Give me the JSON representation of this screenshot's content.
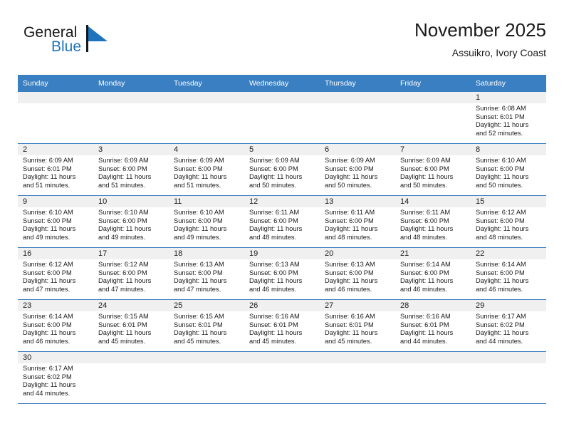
{
  "brand": {
    "name_part1": "General",
    "name_part2": "Blue",
    "flag_icon": "blue-triangle-flag",
    "accent_color": "#1f74bd"
  },
  "header": {
    "title": "November 2025",
    "subtitle": "Assuikro, Ivory Coast"
  },
  "theme": {
    "header_bg": "#3a7fc1",
    "daynum_bg": "#f0f0f0",
    "grid_line": "#3a7fc1",
    "text": "#1a1a1a"
  },
  "weekday_headers": [
    "Sunday",
    "Monday",
    "Tuesday",
    "Wednesday",
    "Thursday",
    "Friday",
    "Saturday"
  ],
  "weeks": [
    [
      {
        "day": "",
        "empty": true
      },
      {
        "day": "",
        "empty": true
      },
      {
        "day": "",
        "empty": true
      },
      {
        "day": "",
        "empty": true
      },
      {
        "day": "",
        "empty": true
      },
      {
        "day": "",
        "empty": true
      },
      {
        "day": "1",
        "sunrise": "Sunrise: 6:08 AM",
        "sunset": "Sunset: 6:01 PM",
        "daylight1": "Daylight: 11 hours",
        "daylight2": "and 52 minutes."
      }
    ],
    [
      {
        "day": "2",
        "sunrise": "Sunrise: 6:09 AM",
        "sunset": "Sunset: 6:01 PM",
        "daylight1": "Daylight: 11 hours",
        "daylight2": "and 51 minutes."
      },
      {
        "day": "3",
        "sunrise": "Sunrise: 6:09 AM",
        "sunset": "Sunset: 6:00 PM",
        "daylight1": "Daylight: 11 hours",
        "daylight2": "and 51 minutes."
      },
      {
        "day": "4",
        "sunrise": "Sunrise: 6:09 AM",
        "sunset": "Sunset: 6:00 PM",
        "daylight1": "Daylight: 11 hours",
        "daylight2": "and 51 minutes."
      },
      {
        "day": "5",
        "sunrise": "Sunrise: 6:09 AM",
        "sunset": "Sunset: 6:00 PM",
        "daylight1": "Daylight: 11 hours",
        "daylight2": "and 50 minutes."
      },
      {
        "day": "6",
        "sunrise": "Sunrise: 6:09 AM",
        "sunset": "Sunset: 6:00 PM",
        "daylight1": "Daylight: 11 hours",
        "daylight2": "and 50 minutes."
      },
      {
        "day": "7",
        "sunrise": "Sunrise: 6:09 AM",
        "sunset": "Sunset: 6:00 PM",
        "daylight1": "Daylight: 11 hours",
        "daylight2": "and 50 minutes."
      },
      {
        "day": "8",
        "sunrise": "Sunrise: 6:10 AM",
        "sunset": "Sunset: 6:00 PM",
        "daylight1": "Daylight: 11 hours",
        "daylight2": "and 50 minutes."
      }
    ],
    [
      {
        "day": "9",
        "sunrise": "Sunrise: 6:10 AM",
        "sunset": "Sunset: 6:00 PM",
        "daylight1": "Daylight: 11 hours",
        "daylight2": "and 49 minutes."
      },
      {
        "day": "10",
        "sunrise": "Sunrise: 6:10 AM",
        "sunset": "Sunset: 6:00 PM",
        "daylight1": "Daylight: 11 hours",
        "daylight2": "and 49 minutes."
      },
      {
        "day": "11",
        "sunrise": "Sunrise: 6:10 AM",
        "sunset": "Sunset: 6:00 PM",
        "daylight1": "Daylight: 11 hours",
        "daylight2": "and 49 minutes."
      },
      {
        "day": "12",
        "sunrise": "Sunrise: 6:11 AM",
        "sunset": "Sunset: 6:00 PM",
        "daylight1": "Daylight: 11 hours",
        "daylight2": "and 48 minutes."
      },
      {
        "day": "13",
        "sunrise": "Sunrise: 6:11 AM",
        "sunset": "Sunset: 6:00 PM",
        "daylight1": "Daylight: 11 hours",
        "daylight2": "and 48 minutes."
      },
      {
        "day": "14",
        "sunrise": "Sunrise: 6:11 AM",
        "sunset": "Sunset: 6:00 PM",
        "daylight1": "Daylight: 11 hours",
        "daylight2": "and 48 minutes."
      },
      {
        "day": "15",
        "sunrise": "Sunrise: 6:12 AM",
        "sunset": "Sunset: 6:00 PM",
        "daylight1": "Daylight: 11 hours",
        "daylight2": "and 48 minutes."
      }
    ],
    [
      {
        "day": "16",
        "sunrise": "Sunrise: 6:12 AM",
        "sunset": "Sunset: 6:00 PM",
        "daylight1": "Daylight: 11 hours",
        "daylight2": "and 47 minutes."
      },
      {
        "day": "17",
        "sunrise": "Sunrise: 6:12 AM",
        "sunset": "Sunset: 6:00 PM",
        "daylight1": "Daylight: 11 hours",
        "daylight2": "and 47 minutes."
      },
      {
        "day": "18",
        "sunrise": "Sunrise: 6:13 AM",
        "sunset": "Sunset: 6:00 PM",
        "daylight1": "Daylight: 11 hours",
        "daylight2": "and 47 minutes."
      },
      {
        "day": "19",
        "sunrise": "Sunrise: 6:13 AM",
        "sunset": "Sunset: 6:00 PM",
        "daylight1": "Daylight: 11 hours",
        "daylight2": "and 46 minutes."
      },
      {
        "day": "20",
        "sunrise": "Sunrise: 6:13 AM",
        "sunset": "Sunset: 6:00 PM",
        "daylight1": "Daylight: 11 hours",
        "daylight2": "and 46 minutes."
      },
      {
        "day": "21",
        "sunrise": "Sunrise: 6:14 AM",
        "sunset": "Sunset: 6:00 PM",
        "daylight1": "Daylight: 11 hours",
        "daylight2": "and 46 minutes."
      },
      {
        "day": "22",
        "sunrise": "Sunrise: 6:14 AM",
        "sunset": "Sunset: 6:00 PM",
        "daylight1": "Daylight: 11 hours",
        "daylight2": "and 46 minutes."
      }
    ],
    [
      {
        "day": "23",
        "sunrise": "Sunrise: 6:14 AM",
        "sunset": "Sunset: 6:00 PM",
        "daylight1": "Daylight: 11 hours",
        "daylight2": "and 46 minutes."
      },
      {
        "day": "24",
        "sunrise": "Sunrise: 6:15 AM",
        "sunset": "Sunset: 6:01 PM",
        "daylight1": "Daylight: 11 hours",
        "daylight2": "and 45 minutes."
      },
      {
        "day": "25",
        "sunrise": "Sunrise: 6:15 AM",
        "sunset": "Sunset: 6:01 PM",
        "daylight1": "Daylight: 11 hours",
        "daylight2": "and 45 minutes."
      },
      {
        "day": "26",
        "sunrise": "Sunrise: 6:16 AM",
        "sunset": "Sunset: 6:01 PM",
        "daylight1": "Daylight: 11 hours",
        "daylight2": "and 45 minutes."
      },
      {
        "day": "27",
        "sunrise": "Sunrise: 6:16 AM",
        "sunset": "Sunset: 6:01 PM",
        "daylight1": "Daylight: 11 hours",
        "daylight2": "and 45 minutes."
      },
      {
        "day": "28",
        "sunrise": "Sunrise: 6:16 AM",
        "sunset": "Sunset: 6:01 PM",
        "daylight1": "Daylight: 11 hours",
        "daylight2": "and 44 minutes."
      },
      {
        "day": "29",
        "sunrise": "Sunrise: 6:17 AM",
        "sunset": "Sunset: 6:02 PM",
        "daylight1": "Daylight: 11 hours",
        "daylight2": "and 44 minutes."
      }
    ],
    [
      {
        "day": "30",
        "sunrise": "Sunrise: 6:17 AM",
        "sunset": "Sunset: 6:02 PM",
        "daylight1": "Daylight: 11 hours",
        "daylight2": "and 44 minutes."
      },
      {
        "day": "",
        "empty": true
      },
      {
        "day": "",
        "empty": true
      },
      {
        "day": "",
        "empty": true
      },
      {
        "day": "",
        "empty": true
      },
      {
        "day": "",
        "empty": true
      },
      {
        "day": "",
        "empty": true
      }
    ]
  ]
}
